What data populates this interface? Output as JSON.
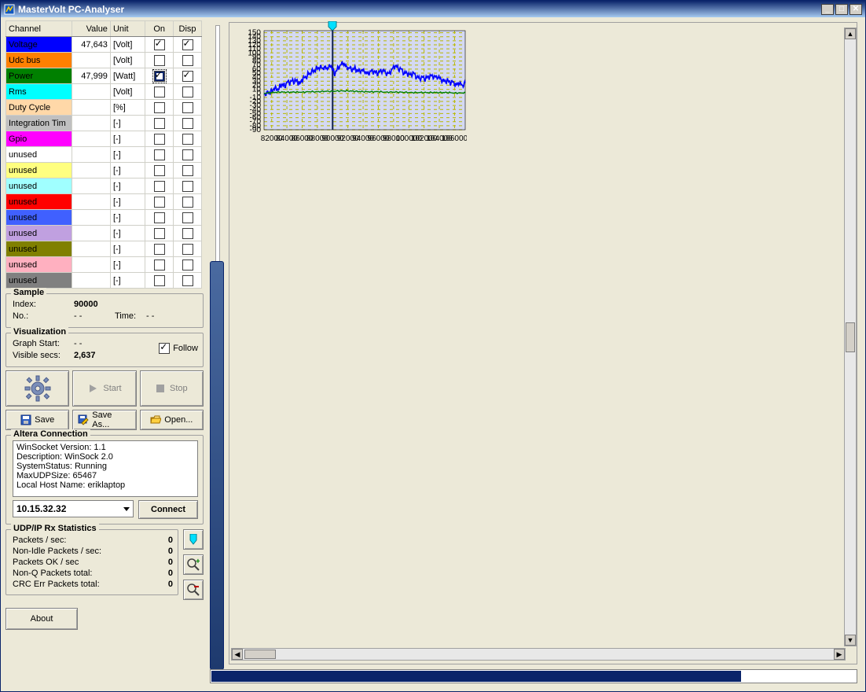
{
  "window": {
    "title": "MasterVolt PC-Analyser"
  },
  "channel_headers": {
    "channel": "Channel",
    "value": "Value",
    "unit": "Unit",
    "on": "On",
    "disp": "Disp"
  },
  "channels": [
    {
      "name": "Voltage",
      "color": "#0000ff",
      "value": "47,643",
      "unit": "[Volt]",
      "on": true,
      "disp": true
    },
    {
      "name": "Udc bus",
      "color": "#ff8000",
      "value": "",
      "unit": "[Volt]",
      "on": false,
      "disp": false
    },
    {
      "name": "Power",
      "color": "#008000",
      "value": "47,999",
      "unit": "[Watt]",
      "on": true,
      "disp": true,
      "on_active": true
    },
    {
      "name": "Rms",
      "color": "#00ffff",
      "value": "",
      "unit": "[Volt]",
      "on": false,
      "disp": false
    },
    {
      "name": "Duty Cycle",
      "color": "#ffd8a8",
      "value": "",
      "unit": "[%]",
      "on": false,
      "disp": false
    },
    {
      "name": "Integration Tim",
      "color": "#c0c0c0",
      "value": "",
      "unit": "[-]",
      "on": false,
      "disp": false
    },
    {
      "name": "Gpio",
      "color": "#ff00ff",
      "value": "",
      "unit": "[-]",
      "on": false,
      "disp": false
    },
    {
      "name": "unused",
      "color": "#ffffff",
      "value": "",
      "unit": "[-]",
      "on": false,
      "disp": false
    },
    {
      "name": "unused",
      "color": "#ffff80",
      "value": "",
      "unit": "[-]",
      "on": false,
      "disp": false
    },
    {
      "name": "unused",
      "color": "#a0ffff",
      "value": "",
      "unit": "[-]",
      "on": false,
      "disp": false
    },
    {
      "name": "unused",
      "color": "#ff0000",
      "value": "",
      "unit": "[-]",
      "on": false,
      "disp": false
    },
    {
      "name": "unused",
      "color": "#4060ff",
      "value": "",
      "unit": "[-]",
      "on": false,
      "disp": false
    },
    {
      "name": "unused",
      "color": "#c0a0e0",
      "value": "",
      "unit": "[-]",
      "on": false,
      "disp": false
    },
    {
      "name": "unused",
      "color": "#808000",
      "value": "",
      "unit": "[-]",
      "on": false,
      "disp": false
    },
    {
      "name": "unused",
      "color": "#ffb0c0",
      "value": "",
      "unit": "[-]",
      "on": false,
      "disp": false
    },
    {
      "name": "unused",
      "color": "#808080",
      "value": "",
      "unit": "[-]",
      "on": false,
      "disp": false
    }
  ],
  "sample": {
    "title": "Sample",
    "index_label": "Index:",
    "index": "90000",
    "no_label": "No.:",
    "no": "- -",
    "time_label": "Time:",
    "time": "- -"
  },
  "visualization": {
    "title": "Visualization",
    "graph_start_label": "Graph Start:",
    "graph_start": "- -",
    "visible_secs_label": "Visible secs:",
    "visible_secs": "2,637",
    "follow_label": "Follow",
    "follow": true
  },
  "buttons": {
    "start": "Start",
    "stop": "Stop",
    "save": "Save",
    "save_as": "Save As...",
    "open": "Open...",
    "connect": "Connect",
    "about": "About"
  },
  "altera": {
    "title": "Altera Connection",
    "lines": [
      "WinSocket Version: 1.1",
      "Description: WinSock 2.0",
      "SystemStatus: Running",
      "MaxUDPSize: 65467",
      "Local Host Name: eriklaptop"
    ],
    "ip": "10.15.32.32"
  },
  "udp": {
    "title": "UDP/IP Rx Statistics",
    "rows": [
      {
        "k": "Packets / sec:",
        "v": "0"
      },
      {
        "k": "Non-Idle Packets / sec:",
        "v": "0"
      },
      {
        "k": "Packets OK / sec",
        "v": "0"
      },
      {
        "k": "Non-Q Packets total:",
        "v": "0"
      },
      {
        "k": "CRC Err Packets total:",
        "v": "0"
      }
    ]
  },
  "chart_data": {
    "type": "line",
    "xlabel": "",
    "ylabel": "",
    "xlim": [
      81000,
      107400
    ],
    "ylim": [
      -90,
      155
    ],
    "xticks": [
      82000,
      84000,
      86000,
      88000,
      90000,
      92000,
      94000,
      96000,
      98000,
      100000,
      102000,
      104000,
      106000
    ],
    "yticks": [
      -90,
      -80,
      -70,
      -60,
      -50,
      -40,
      -30,
      -20,
      -10,
      0,
      10,
      20,
      30,
      40,
      50,
      60,
      70,
      80,
      90,
      100,
      110,
      120,
      130,
      140,
      150
    ],
    "cursor_x": 90000,
    "series": [
      {
        "name": "Voltage",
        "color": "#0000ff",
        "x": [
          81000,
          81400,
          81700,
          82000,
          82300,
          82700,
          83000,
          83300,
          83700,
          84000,
          84300,
          84700,
          85000,
          85400,
          85700,
          86000,
          86400,
          86700,
          87000,
          87400,
          87800,
          88200,
          88600,
          89000,
          89400,
          89800,
          90000,
          90200,
          90600,
          91000,
          91400,
          91800,
          92200,
          92600,
          93000,
          93400,
          93800,
          94200,
          94600,
          95000,
          95400,
          95800,
          96200,
          96600,
          97000,
          97400,
          97800,
          98200,
          98600,
          99000,
          99400,
          99800,
          100200,
          100600,
          101000,
          101400,
          101800,
          102200,
          102600,
          103000,
          103400,
          103800,
          104200,
          104600,
          105000,
          105400,
          105800,
          106200,
          106600,
          107000,
          107400
        ],
        "values": [
          -2,
          3,
          1,
          6,
          12,
          9,
          14,
          22,
          18,
          28,
          25,
          32,
          30,
          29,
          24,
          33,
          40,
          45,
          50,
          55,
          60,
          63,
          62,
          65,
          61,
          68,
          60,
          48,
          60,
          70,
          73,
          67,
          62,
          58,
          61,
          55,
          58,
          52,
          50,
          55,
          53,
          50,
          54,
          58,
          48,
          50,
          60,
          67,
          62,
          60,
          50,
          48,
          46,
          52,
          38,
          38,
          40,
          36,
          40,
          44,
          42,
          38,
          36,
          30,
          32,
          26,
          28,
          22,
          24,
          20,
          26
        ]
      },
      {
        "name": "Power",
        "color": "#008000",
        "x": [
          81000,
          82000,
          83000,
          84000,
          85000,
          86000,
          87000,
          88000,
          89000,
          90000,
          91000,
          92000,
          93000,
          94000,
          95000,
          96000,
          97000,
          98000,
          99000,
          100000,
          101000,
          102000,
          103000,
          104000,
          105000,
          106000,
          107000,
          107400
        ],
        "values": [
          0,
          2,
          3,
          3,
          3,
          3,
          4,
          4,
          5,
          5,
          6,
          6,
          5,
          4,
          4,
          4,
          3,
          3,
          3,
          2,
          2,
          2,
          2,
          2,
          2,
          1,
          1,
          1
        ]
      }
    ]
  }
}
